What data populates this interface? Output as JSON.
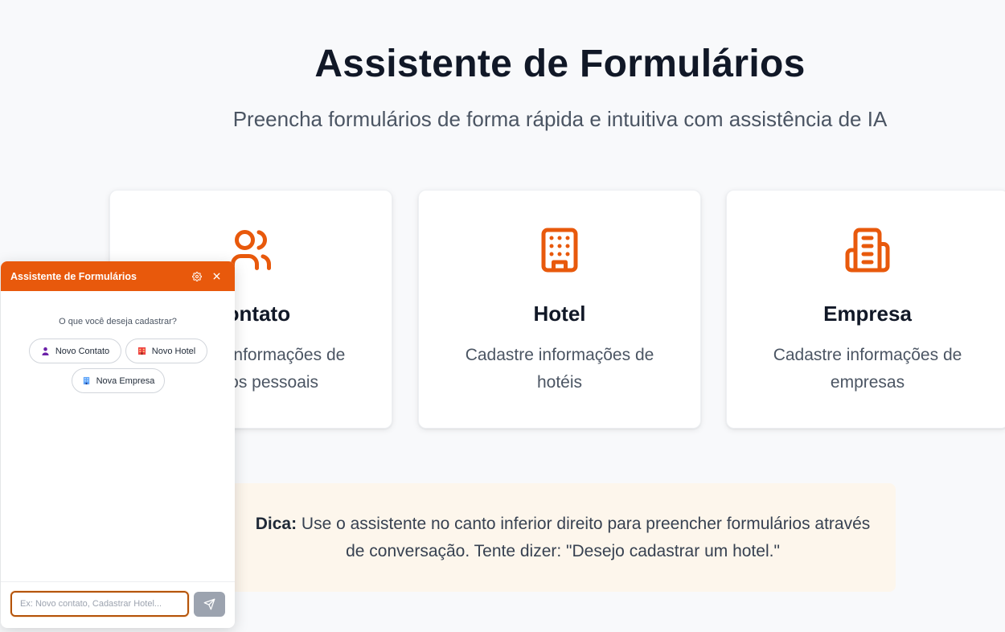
{
  "hero": {
    "title": "Assistente de Formulários",
    "subtitle": "Preencha formulários de forma rápida e intuitiva com assistência de IA"
  },
  "cards": [
    {
      "title": "Contato",
      "description": "Cadastre informações de contatos pessoais",
      "icon": "users-icon"
    },
    {
      "title": "Hotel",
      "description": "Cadastre informações de hotéis",
      "icon": "hotel-icon"
    },
    {
      "title": "Empresa",
      "description": "Cadastre informações de empresas",
      "icon": "building-icon"
    }
  ],
  "tip": {
    "label": "Dica:",
    "text": " Use o assistente no canto inferior direito para preencher formulários através de conversação. Tente dizer: \"Desejo cadastrar um hotel.\""
  },
  "chat": {
    "title": "Assistente de Formulários",
    "prompt": "O que você deseja cadastrar?",
    "options": [
      {
        "label": "Novo Contato",
        "icon": "person-icon"
      },
      {
        "label": "Novo Hotel",
        "icon": "hotel-icon"
      },
      {
        "label": "Nova Empresa",
        "icon": "office-icon"
      }
    ],
    "input_placeholder": "Ex: Novo contato, Cadastrar Hotel..."
  },
  "colors": {
    "accent": "#e8590c",
    "background": "#f8f9fb",
    "tip_background": "#fdf6ec",
    "send_button": "#9ca3af"
  }
}
